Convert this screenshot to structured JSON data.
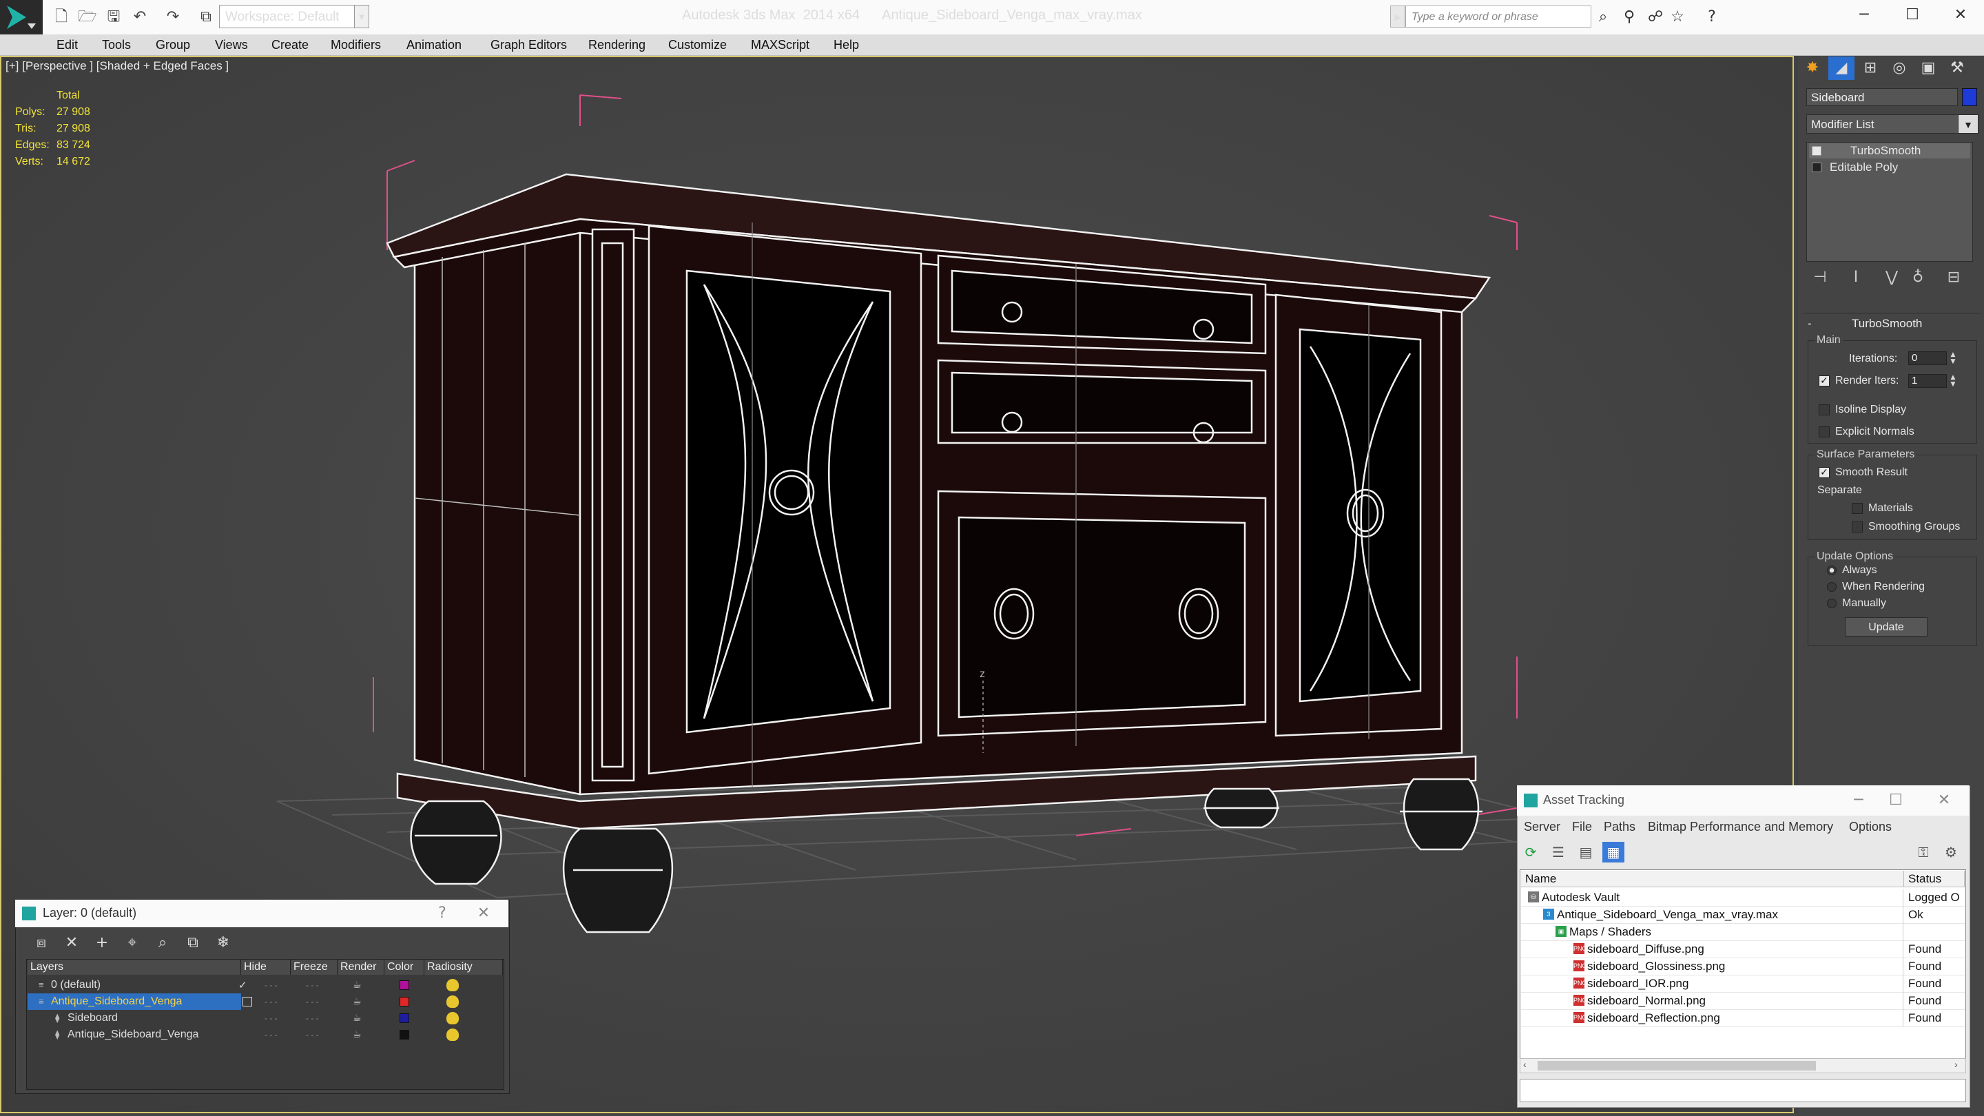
{
  "titlebar": {
    "workspace": "Workspace: Default",
    "title": "Autodesk 3ds Max  2014 x64      Antique_Sideboard_Venga_max_vray.max",
    "search_placeholder": "Type a keyword or phrase"
  },
  "menu": [
    "Edit",
    "Tools",
    "Group",
    "Views",
    "Create",
    "Modifiers",
    "Animation",
    "Graph Editors",
    "Rendering",
    "Customize",
    "MAXScript",
    "Help"
  ],
  "viewport": {
    "label": "[+] [Perspective ] [Shaded + Edged Faces ]",
    "stats_header": "Total",
    "stats": [
      {
        "label": "Polys:",
        "value": "27 908"
      },
      {
        "label": "Tris:",
        "value": "27 908"
      },
      {
        "label": "Edges:",
        "value": "83 724"
      },
      {
        "label": "Verts:",
        "value": "14 672"
      }
    ],
    "axis_label": "z",
    "wire_color": "#f2f2f2",
    "body_color": "#1c0a0a",
    "bbox_color": "#e0508a"
  },
  "command_panel": {
    "object_name": "Sideboard",
    "object_color": "#1e3bd8",
    "modifier_list": "Modifier List",
    "stack": [
      "TurboSmooth",
      "Editable Poly"
    ],
    "rollout_title": "TurboSmooth",
    "main_group": "Main",
    "iterations_label": "Iterations:",
    "iterations_value": "0",
    "render_iters_label": "Render Iters:",
    "render_iters_value": "1",
    "isoline_label": "Isoline Display",
    "explicit_normals_label": "Explicit Normals",
    "surface_group": "Surface Parameters",
    "smooth_result_label": "Smooth Result",
    "separate_label": "Separate",
    "materials_label": "Materials",
    "smoothing_groups_label": "Smoothing Groups",
    "update_group": "Update Options",
    "always_label": "Always",
    "when_rendering_label": "When Rendering",
    "manually_label": "Manually",
    "update_button": "Update"
  },
  "layer_dialog": {
    "title": "Layer: 0 (default)",
    "help": "?",
    "close": "✕",
    "columns": [
      "Layers",
      "Hide",
      "Freeze",
      "Render",
      "Color",
      "Radiosity"
    ],
    "rows": [
      {
        "name": "0 (default)",
        "color": "#b0109a",
        "selected": false
      },
      {
        "name": "Antique_Sideboard_Venga",
        "color": "#e02828",
        "selected": true
      },
      {
        "name": "Sideboard",
        "color": "#1e1ea0",
        "selected": false
      },
      {
        "name": "Antique_Sideboard_Venga",
        "color": "#111111",
        "selected": false
      }
    ]
  },
  "asset_dialog": {
    "title": "Asset Tracking",
    "menu": [
      "Server",
      "File",
      "Paths",
      "Bitmap Performance and Memory",
      "Options"
    ],
    "columns": [
      "Name",
      "Status"
    ],
    "rows": [
      {
        "name": "Autodesk Vault",
        "status": "Logged O"
      },
      {
        "name": "Antique_Sideboard_Venga_max_vray.max",
        "status": "Ok"
      },
      {
        "name": "Maps / Shaders",
        "status": ""
      },
      {
        "name": "sideboard_Diffuse.png",
        "status": "Found"
      },
      {
        "name": "sideboard_Glossiness.png",
        "status": "Found"
      },
      {
        "name": "sideboard_IOR.png",
        "status": "Found"
      },
      {
        "name": "sideboard_Normal.png",
        "status": "Found"
      },
      {
        "name": "sideboard_Reflection.png",
        "status": "Found"
      }
    ]
  }
}
